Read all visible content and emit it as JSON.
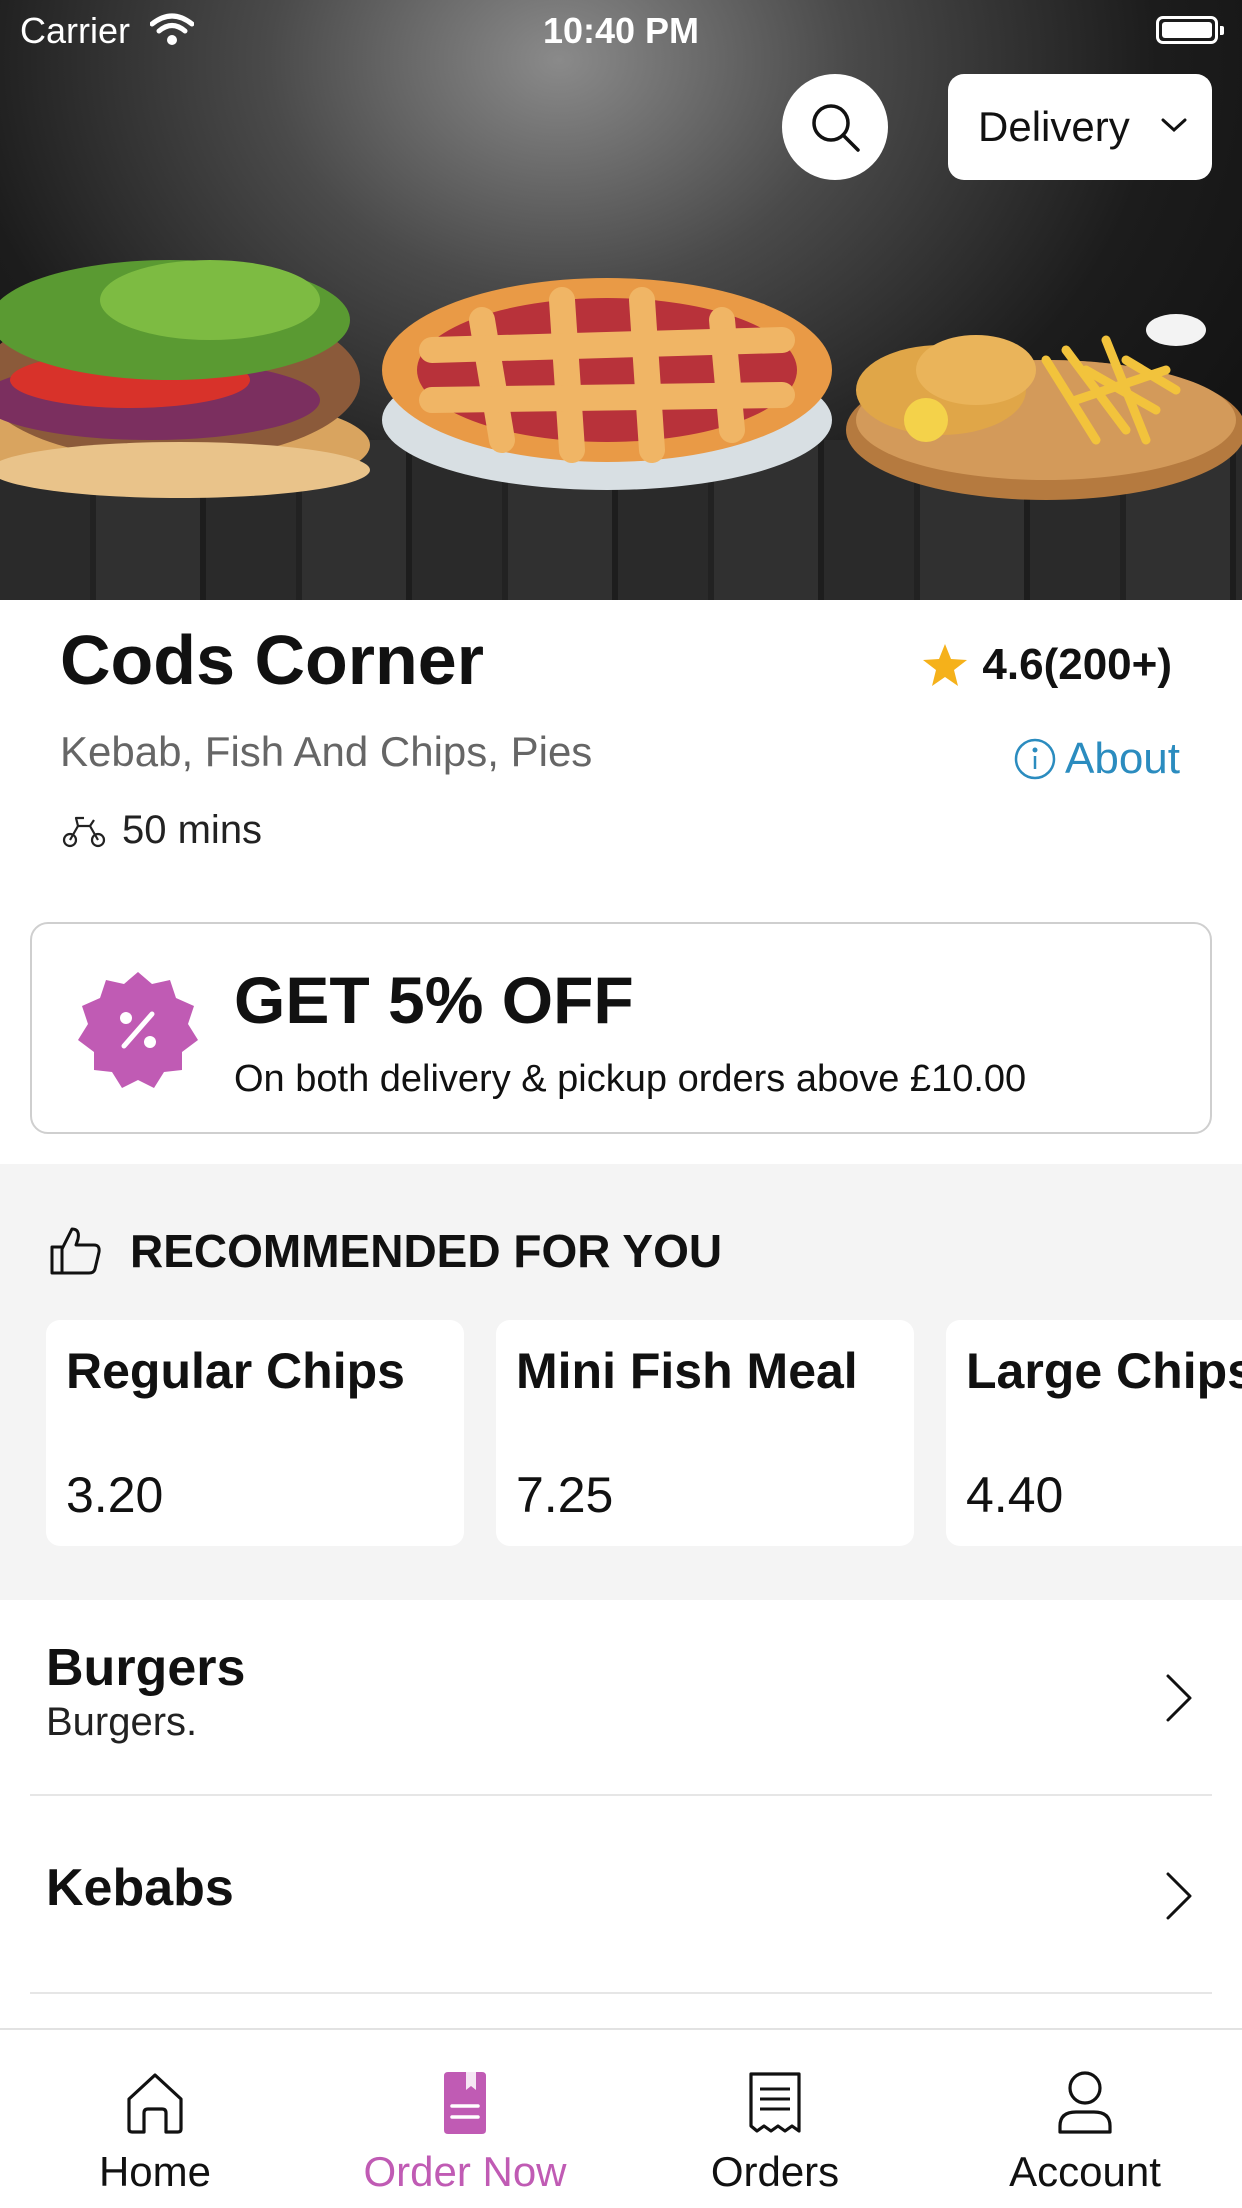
{
  "status_bar": {
    "carrier": "Carrier",
    "time": "10:40 PM"
  },
  "header": {
    "search_icon": "search-icon",
    "fulfilment_mode": "Delivery"
  },
  "restaurant": {
    "name": "Cods Corner",
    "rating": "4.6(200+)",
    "cuisines": "Kebab, Fish And Chips, Pies",
    "about_label": "About",
    "delivery_time": "50 mins"
  },
  "offer": {
    "title": "GET 5% OFF",
    "subtitle": "On both delivery & pickup orders above £10.00",
    "badge_color": "#c05bb4"
  },
  "recommended": {
    "heading": "RECOMMENDED FOR YOU",
    "items": [
      {
        "name": "Regular Chips",
        "price": "3.20"
      },
      {
        "name": "Mini Fish Meal",
        "price": "7.25"
      },
      {
        "name": "Large Chips",
        "price": "4.40"
      }
    ]
  },
  "categories": [
    {
      "title": "Burgers",
      "description": "Burgers."
    },
    {
      "title": "Kebabs",
      "description": ""
    }
  ],
  "tabbar": {
    "accent": "#c05bb4",
    "tabs": [
      {
        "label": "Home",
        "icon": "home-icon"
      },
      {
        "label": "Order Now",
        "icon": "order-now-icon",
        "active": true
      },
      {
        "label": "Orders",
        "icon": "receipt-icon"
      },
      {
        "label": "Account",
        "icon": "user-icon"
      }
    ]
  }
}
